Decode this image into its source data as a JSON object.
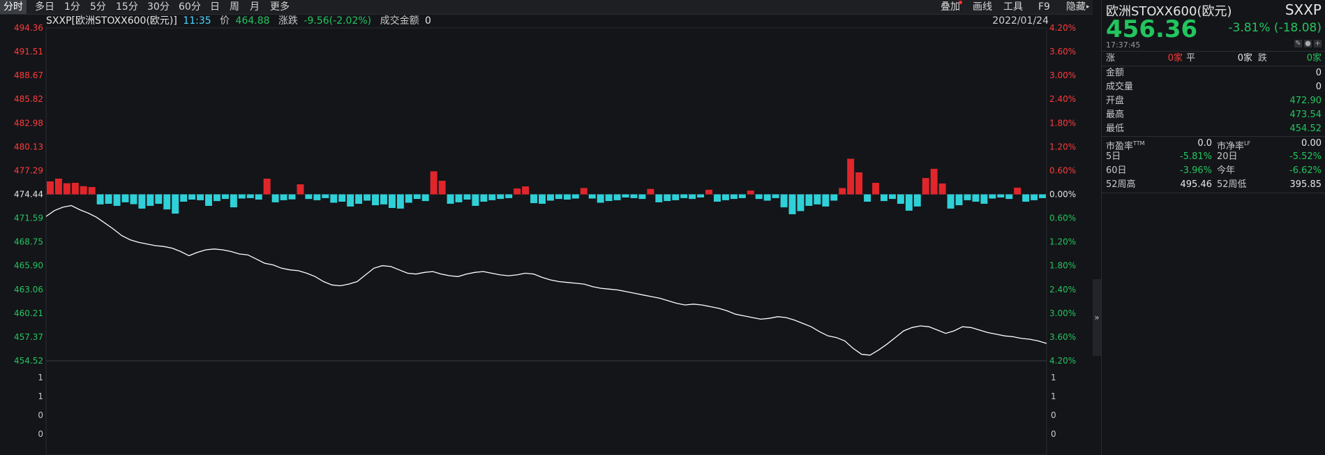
{
  "toolbar": {
    "tabs": [
      "分时",
      "多日",
      "1分",
      "5分",
      "15分",
      "30分",
      "60分",
      "日",
      "周",
      "月",
      "更多"
    ],
    "active_tab": "分时",
    "right": [
      "叠加",
      "画线",
      "工具",
      "F9",
      "隐藏"
    ]
  },
  "info": {
    "symbol": "SXXP[欧洲STOXX600(欧元)]",
    "time": "11:35",
    "price_label": "价",
    "price": "464.88",
    "change_label": "涨跌",
    "change": "-9.56(-2.02%)",
    "amount_label": "成交金额",
    "amount": "0",
    "date": "2022/01/24"
  },
  "axes": {
    "left_prices": [
      "494.36",
      "491.51",
      "488.67",
      "485.82",
      "482.98",
      "480.13",
      "477.29",
      "474.44",
      "471.59",
      "468.75",
      "465.90",
      "463.06",
      "460.21",
      "457.37",
      "454.52"
    ],
    "right_pcts": [
      "4.20%",
      "3.60%",
      "3.00%",
      "2.40%",
      "1.80%",
      "1.20%",
      "0.60%",
      "0.00%",
      "0.60%",
      "1.20%",
      "1.80%",
      "2.40%",
      "3.00%",
      "3.60%",
      "4.20%"
    ],
    "volume_labels": [
      "1",
      "1",
      "0",
      "0"
    ]
  },
  "chart_data": {
    "type": "line",
    "ylim": [
      454.52,
      494.36
    ],
    "reference": 474.44,
    "series": [
      {
        "values": [
          471.8,
          472.5,
          472.9,
          473.1,
          472.6,
          472.2,
          471.7,
          471.0,
          470.3,
          469.5,
          469.0,
          468.7,
          468.5,
          468.3,
          468.2,
          468.0,
          467.6,
          467.1,
          467.5,
          467.8,
          467.9,
          467.8,
          467.6,
          467.3,
          467.2,
          466.7,
          466.2,
          466.0,
          465.6,
          465.4,
          465.3,
          465.0,
          464.6,
          464.0,
          463.6,
          463.5,
          463.7,
          464.0,
          464.8,
          465.6,
          465.9,
          465.8,
          465.4,
          465.0,
          464.9,
          465.1,
          465.2,
          464.9,
          464.7,
          464.6,
          464.9,
          465.1,
          465.2,
          465.0,
          464.8,
          464.7,
          464.8,
          465.0,
          464.9,
          464.5,
          464.2,
          464.0,
          463.9,
          463.8,
          463.7,
          463.4,
          463.2,
          463.1,
          463.0,
          462.8,
          462.6,
          462.4,
          462.2,
          462.0,
          461.7,
          461.4,
          461.2,
          461.3,
          461.2,
          461.0,
          460.8,
          460.5,
          460.1,
          459.9,
          459.7,
          459.5,
          459.6,
          459.8,
          459.7,
          459.4,
          459.0,
          458.6,
          458.0,
          457.5,
          457.3,
          456.9,
          456.0,
          455.3,
          455.2,
          455.8,
          456.5,
          457.3,
          458.1,
          458.5,
          458.7,
          458.6,
          458.2,
          457.8,
          458.1,
          458.6,
          458.5,
          458.2,
          457.9,
          457.7,
          457.5,
          457.4,
          457.2,
          457.1,
          456.9,
          456.6
        ]
      },
      {
        "name": "volume",
        "values": [
          0.62,
          0.75,
          0.53,
          0.55,
          0.39,
          0.35,
          -0.48,
          -0.45,
          -0.55,
          -0.38,
          -0.47,
          -0.68,
          -0.55,
          -0.45,
          -0.72,
          -0.92,
          -0.35,
          -0.25,
          -0.28,
          -0.55,
          -0.32,
          -0.22,
          -0.62,
          -0.2,
          -0.18,
          -0.25,
          0.75,
          -0.38,
          -0.28,
          -0.24,
          0.48,
          -0.22,
          -0.28,
          -0.18,
          -0.4,
          -0.35,
          -0.58,
          -0.45,
          -0.3,
          -0.52,
          -0.48,
          -0.65,
          -0.68,
          -0.4,
          -0.22,
          -0.32,
          1.1,
          0.65,
          -0.45,
          -0.38,
          -0.25,
          -0.55,
          -0.35,
          -0.28,
          -0.22,
          -0.18,
          0.28,
          0.38,
          -0.42,
          -0.45,
          -0.3,
          -0.22,
          -0.25,
          -0.2,
          0.3,
          -0.2,
          -0.4,
          -0.32,
          -0.28,
          -0.15,
          -0.18,
          -0.22,
          0.26,
          -0.38,
          -0.32,
          -0.28,
          -0.18,
          -0.22,
          -0.15,
          0.22,
          -0.35,
          -0.28,
          -0.22,
          -0.18,
          0.18,
          -0.22,
          -0.3,
          -0.18,
          -0.62,
          -0.95,
          -0.8,
          -0.55,
          -0.48,
          -0.58,
          -0.3,
          0.3,
          1.7,
          1.05,
          -0.35,
          0.55,
          -0.32,
          -0.22,
          -0.45,
          -0.78,
          -0.58,
          0.78,
          1.22,
          0.52,
          -0.68,
          -0.52,
          -0.28,
          -0.35,
          -0.45,
          -0.2,
          -0.15,
          -0.22,
          0.32,
          -0.35,
          -0.28,
          -0.18
        ]
      }
    ]
  },
  "sidebar": {
    "name": "欧洲STOXX600(欧元)",
    "code": "SXXP",
    "price": "456.36",
    "change": "-3.81% (-18.08)",
    "time": "17:37:45",
    "updown": {
      "up_label": "涨",
      "up_val": "0家",
      "flat_label": "平",
      "flat_val": "0家",
      "down_label": "跌",
      "down_val": "0家"
    },
    "rows": [
      {
        "label": "金额",
        "value": "0"
      },
      {
        "label": "成交量",
        "value": "0"
      },
      {
        "label": "开盘",
        "value": "472.90"
      },
      {
        "label": "最高",
        "value": "473.54"
      },
      {
        "label": "最低",
        "value": "454.52"
      }
    ],
    "pe_label": "市盈率",
    "pe_sup": "TTM",
    "pe": "0.0",
    "pb_label": "市净率",
    "pb_sup": "LF",
    "pb": "0.00",
    "perf": [
      {
        "l1": "5日",
        "v1": "-5.81%",
        "l2": "20日",
        "v2": "-5.52%"
      },
      {
        "l1": "60日",
        "v1": "-3.96%",
        "l2": "今年",
        "v2": "-6.62%"
      }
    ],
    "high52_label": "52周高",
    "high52": "495.46",
    "low52_label": "52周低",
    "low52": "395.85"
  },
  "colors": {
    "up": "#e0262b",
    "down": "#2fd0d8",
    "line": "#ffffff",
    "green": "#22c55e",
    "red": "#ff3b3b",
    "grid": "#2a2c31"
  }
}
